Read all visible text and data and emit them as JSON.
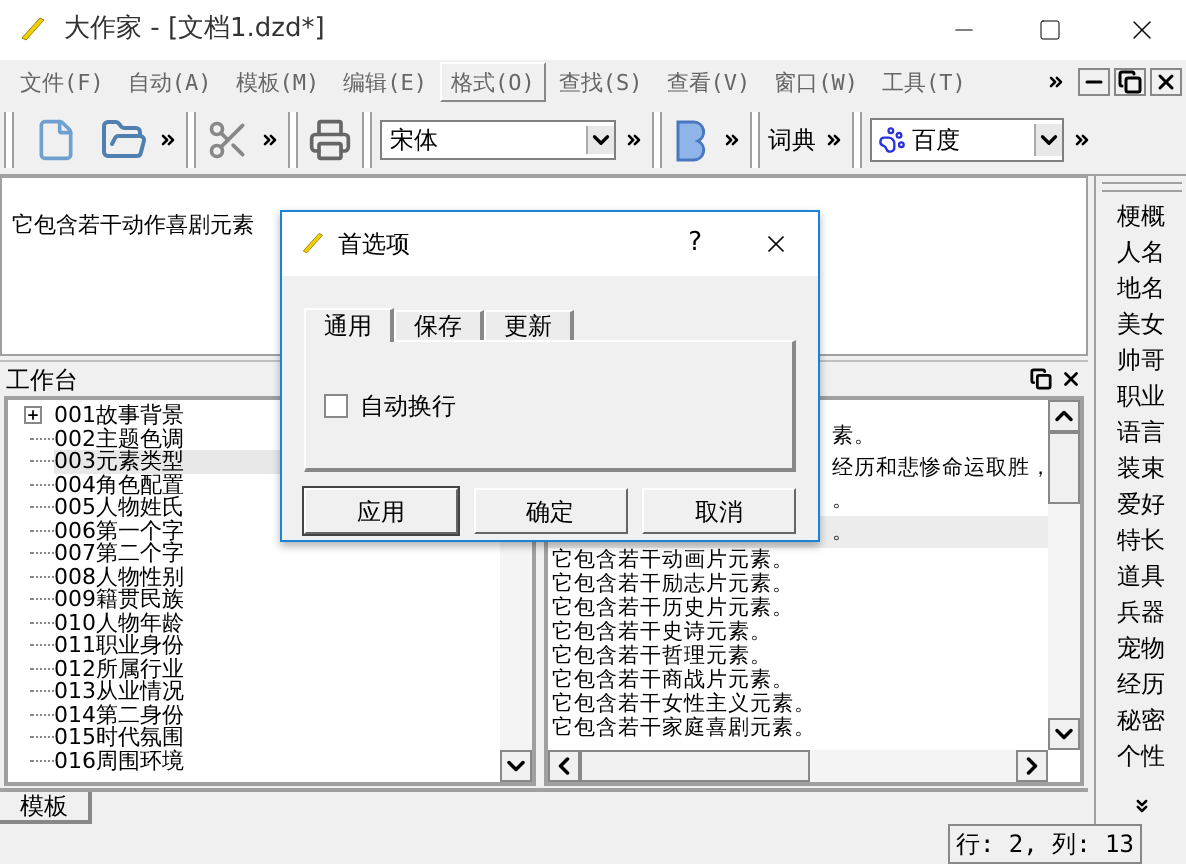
{
  "window": {
    "title": "大作家 - [文档1.dzd*]"
  },
  "menu": [
    {
      "label": "文件(F)",
      "selected": false
    },
    {
      "label": "自动(A)",
      "selected": false
    },
    {
      "label": "模板(M)",
      "selected": false
    },
    {
      "label": "编辑(E)",
      "selected": false
    },
    {
      "label": "格式(O)",
      "selected": true
    },
    {
      "label": "查找(S)",
      "selected": false
    },
    {
      "label": "查看(V)",
      "selected": false
    },
    {
      "label": "窗口(W)",
      "selected": false
    },
    {
      "label": "工具(T)",
      "selected": false
    }
  ],
  "toolbar": {
    "font": "宋体",
    "dictionary": "词典",
    "search_engine": "百度"
  },
  "editor": {
    "text": "它包含若干动作喜剧元素"
  },
  "side_panel": {
    "items": [
      "梗概",
      "人名",
      "地名",
      "美女",
      "帅哥",
      "职业",
      "语言",
      "装束",
      "爱好",
      "特长",
      "道具",
      "兵器",
      "宠物",
      "经历",
      "秘密",
      "个性"
    ]
  },
  "workbench": {
    "title": "工作台",
    "tree": [
      {
        "label": "001故事背景",
        "expandable": true,
        "selected": false
      },
      {
        "label": "002主题色调",
        "expandable": false,
        "selected": false
      },
      {
        "label": "003元素类型",
        "expandable": false,
        "selected": true
      },
      {
        "label": "004角色配置",
        "expandable": false,
        "selected": false
      },
      {
        "label": "005人物姓氏",
        "expandable": false,
        "selected": false
      },
      {
        "label": "006第一个字",
        "expandable": false,
        "selected": false
      },
      {
        "label": "007第二个字",
        "expandable": false,
        "selected": false
      },
      {
        "label": "008人物性别",
        "expandable": false,
        "selected": false
      },
      {
        "label": "009籍贯民族",
        "expandable": false,
        "selected": false
      },
      {
        "label": "010人物年龄",
        "expandable": false,
        "selected": false
      },
      {
        "label": "011职业身份",
        "expandable": false,
        "selected": false
      },
      {
        "label": "012所属行业",
        "expandable": false,
        "selected": false
      },
      {
        "label": "013从业情况",
        "expandable": false,
        "selected": false
      },
      {
        "label": "014第二身份",
        "expandable": false,
        "selected": false
      },
      {
        "label": "015时代氛围",
        "expandable": false,
        "selected": false
      },
      {
        "label": "016周围环境",
        "expandable": false,
        "selected": false
      }
    ],
    "lines": [
      {
        "text": "素。",
        "covered": true,
        "selected": false
      },
      {
        "text": "经历和悲惨命运取胜，",
        "covered": true,
        "selected": false
      },
      {
        "text": "。",
        "covered": true,
        "selected": false
      },
      {
        "text": "。",
        "covered": true,
        "selected": true
      },
      {
        "text": "它包含若干动画片元素。",
        "covered": false,
        "selected": false
      },
      {
        "text": "它包含若干励志片元素。",
        "covered": false,
        "selected": false
      },
      {
        "text": "它包含若干历史片元素。",
        "covered": false,
        "selected": false
      },
      {
        "text": "它包含若干史诗元素。",
        "covered": false,
        "selected": false
      },
      {
        "text": "它包含若干哲理元素。",
        "covered": false,
        "selected": false
      },
      {
        "text": "它包含若干商战片元素。",
        "covered": false,
        "selected": false
      },
      {
        "text": "它包含若干女性主义元素。",
        "covered": false,
        "selected": false
      },
      {
        "text": "它包含若干家庭喜剧元素。",
        "covered": false,
        "selected": false
      }
    ]
  },
  "bottom_tabs": [
    {
      "label": "模板",
      "selected": true
    }
  ],
  "status_bar": {
    "position": "行: 2, 列: 13"
  },
  "dialog": {
    "title": "首选项",
    "help": "?",
    "tabs": [
      {
        "label": "通用",
        "selected": true
      },
      {
        "label": "保存",
        "selected": false
      },
      {
        "label": "更新",
        "selected": false
      }
    ],
    "checkbox": {
      "label": "自动换行",
      "checked": false
    },
    "buttons": [
      {
        "label": "应用",
        "default": true
      },
      {
        "label": "确定",
        "default": false
      },
      {
        "label": "取消",
        "default": false
      }
    ]
  }
}
